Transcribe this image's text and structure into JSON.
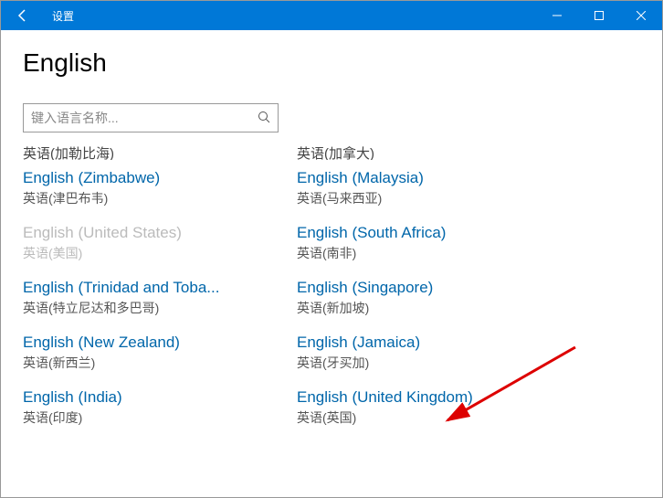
{
  "titlebar": {
    "title": "设置"
  },
  "page": {
    "heading": "English"
  },
  "search": {
    "placeholder": "键入语言名称..."
  },
  "partial": {
    "left": "英语(加勒比海)",
    "right": "英语(加拿大)"
  },
  "languages": [
    {
      "name": "English (Zimbabwe)",
      "sub": "英语(津巴布韦)",
      "disabled": false
    },
    {
      "name": "English (Malaysia)",
      "sub": "英语(马来西亚)",
      "disabled": false
    },
    {
      "name": "English (United States)",
      "sub": "英语(美国)",
      "disabled": true
    },
    {
      "name": "English (South Africa)",
      "sub": "英语(南非)",
      "disabled": false
    },
    {
      "name": "English (Trinidad and Toba...",
      "sub": "英语(特立尼达和多巴哥)",
      "disabled": false
    },
    {
      "name": "English (Singapore)",
      "sub": "英语(新加坡)",
      "disabled": false
    },
    {
      "name": "English (New Zealand)",
      "sub": "英语(新西兰)",
      "disabled": false
    },
    {
      "name": "English (Jamaica)",
      "sub": "英语(牙买加)",
      "disabled": false
    },
    {
      "name": "English (India)",
      "sub": "英语(印度)",
      "disabled": false
    },
    {
      "name": "English (United Kingdom)",
      "sub": "英语(英国)",
      "disabled": false
    }
  ]
}
